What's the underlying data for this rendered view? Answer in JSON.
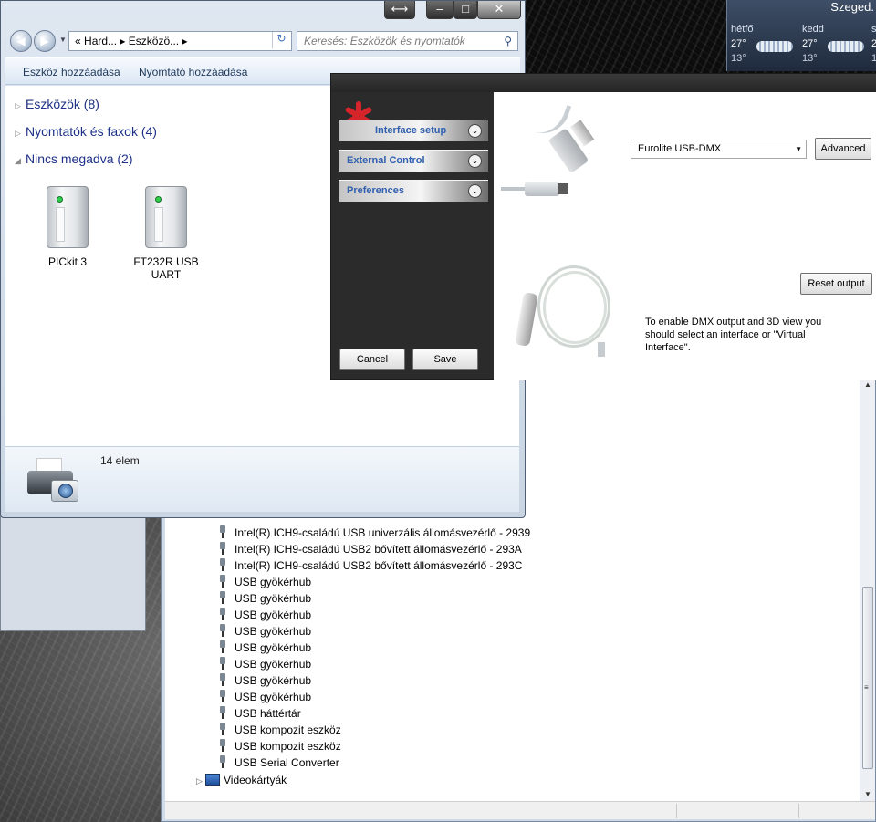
{
  "weather": {
    "city": "Szeged.",
    "days": [
      {
        "name": "hétfő",
        "high": "27°",
        "low": "13°"
      },
      {
        "name": "kedd",
        "high": "27°",
        "low": "13°"
      },
      {
        "name": "s",
        "high": "2",
        "low": "1"
      }
    ]
  },
  "explorer": {
    "caption_buttons": {
      "resize": "⟷",
      "minimize": "–",
      "maximize": "□",
      "close": "✕"
    },
    "address_parts": [
      "«",
      "Hard...",
      "▸",
      "Eszközö...",
      "▸"
    ],
    "search_placeholder": "Keresés: Eszközök és nyomtatók",
    "toolbar": {
      "add_device": "Eszköz hozzáadása",
      "add_printer": "Nyomtató hozzáadása"
    },
    "groups": [
      {
        "label": "Eszközök (8)",
        "expanded": false
      },
      {
        "label": "Nyomtatók és faxok (4)",
        "expanded": false
      },
      {
        "label": "Nincs megadva (2)",
        "expanded": true
      }
    ],
    "devices": [
      {
        "label": "PICkit 3"
      },
      {
        "label": "FT232R USB UART"
      }
    ],
    "item_count": "14 elem"
  },
  "device_manager": {
    "rows": [
      "Intel(R) ICH9-családú USB univerzális állomásvezérlő - 2939",
      "Intel(R) ICH9-családú USB2 bővített állomásvezérlő - 293A",
      "Intel(R) ICH9-családú USB2 bővített állomásvezérlő - 293C",
      "USB gyökérhub",
      "USB gyökérhub",
      "USB gyökérhub",
      "USB gyökérhub",
      "USB gyökérhub",
      "USB gyökérhub",
      "USB gyökérhub",
      "USB gyökérhub",
      "USB háttértár",
      "USB kompozit eszköz",
      "USB kompozit eszköz",
      "USB Serial Converter"
    ],
    "video_category": "Videokártyák"
  },
  "dmx_dialog": {
    "menu": [
      {
        "label": "Interface setup",
        "active": true
      },
      {
        "label": "External Control",
        "active": false
      },
      {
        "label": "Preferences",
        "active": false
      }
    ],
    "cancel": "Cancel",
    "save": "Save",
    "interface_selected": "Eurolite USB-DMX",
    "advanced": "Advanced",
    "reset_output": "Reset output",
    "message": "To enable DMX output and 3D view you should select an interface or \"Virtual Interface\"."
  },
  "colors": {
    "accent_link": "#1e3287",
    "dmx_menu_text": "#2f5fae",
    "logo_red": "#d6242b"
  }
}
